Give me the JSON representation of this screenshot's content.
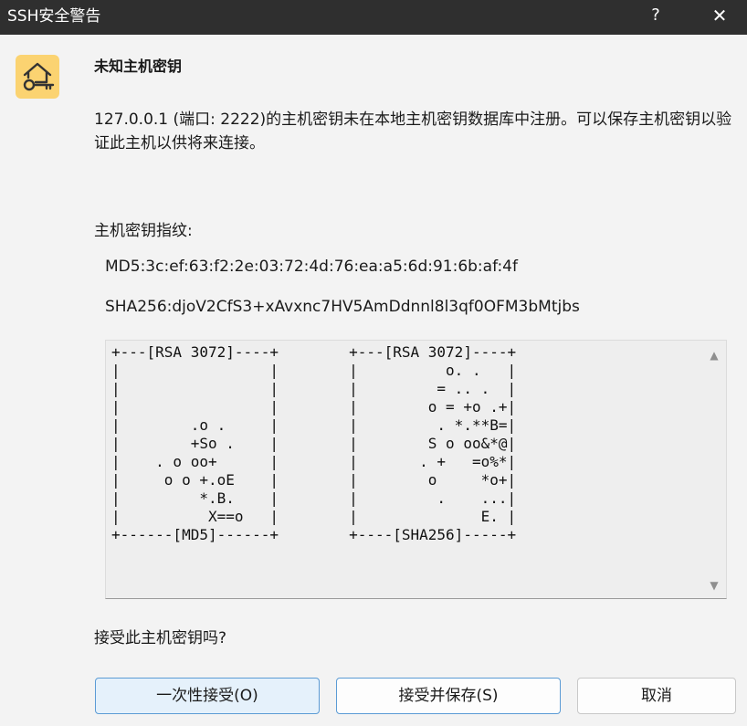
{
  "window": {
    "title": "SSH安全警告",
    "help_label": "?",
    "close_label": "✕"
  },
  "icon": {
    "name": "house-key-icon",
    "accent": "#fbd371"
  },
  "heading": "未知主机密钥",
  "message": "127.0.0.1 (端口: 2222)的主机密钥未在本地主机密钥数据库中注册。可以保存主机密钥以验证此主机以供将来连接。",
  "fingerprint": {
    "label": "主机密钥指纹:",
    "md5": "MD5:3c:ef:63:f2:2e:03:72:4d:76:ea:a5:6d:91:6b:af:4f",
    "sha256": "SHA256:djoV2CfS3+xAvxnc7HV5AmDdnnl8l3qf0OFM3bMtjbs"
  },
  "randomart": "+---[RSA 3072]----+        +---[RSA 3072]----+\n|                 |        |          o. .   |\n|                 |        |         = .. .  |\n|                 |        |        o = +o .+|\n|        .o .     |        |         . *.**B=|\n|        +So .    |        |        S o oo&*@|\n|    . o oo+      |        |       . +   =o%*|\n|     o o +.oE    |        |        o     *o+|\n|         *.B.    |        |         .    ...|\n|          X==o   |        |              E. |\n+------[MD5]------+        +----[SHA256]-----+",
  "scroll": {
    "up": "▲",
    "down": "▼"
  },
  "question": "接受此主机密钥吗?",
  "buttons": {
    "accept_once": "一次性接受(O)",
    "accept_save": "接受并保存(S)",
    "cancel": "取消"
  }
}
